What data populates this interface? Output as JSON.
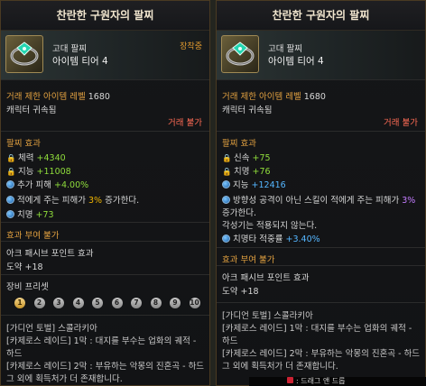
{
  "left": {
    "title": "찬란한 구원자의 팔찌",
    "grade": "고대 팔찌",
    "tier": "아이템 티어 4",
    "equipped": "장착중",
    "level_label": "거래 제한 아이템 레벨",
    "level_value": "1680",
    "bound": "캐릭터 귀속됨",
    "trade": "거래 불가",
    "effect_title": "팔찌 효과",
    "effects": [
      {
        "icon": "lock-icon",
        "name": "체력",
        "value": "+4340"
      },
      {
        "icon": "lock-icon",
        "name": "지능",
        "value": "+11008"
      },
      {
        "icon": "gem-icon",
        "name": "추가 피해",
        "value": "+4.00%"
      }
    ],
    "damage_pre": "적에게 주는 피해가",
    "damage_value": "3%",
    "damage_post": "증가한다.",
    "crit_name": "치명",
    "crit_value": "+73",
    "effect_give": "효과 부여 불가",
    "arc_title": "아크 패시브 포인트 효과",
    "arc_value": "도약 +18",
    "preset_title": "장비 프리셋",
    "preset_numbers": [
      "1",
      "2",
      "3",
      "4",
      "5",
      "6",
      "7",
      "8",
      "9",
      "10"
    ],
    "set_lines": [
      "[가디언 토벌] 스콜라키아",
      "[카제로스 레이드] 1막 : 대지를 부수는 업화의 궤적 -",
      "하드",
      "[카제로스 레이드] 2막 : 부유하는 악몽의 진혼곡 - 하드",
      "그 외에 획득처가 더 존재합니다."
    ]
  },
  "right": {
    "title": "찬란한 구원자의 팔찌",
    "grade": "고대 팔찌",
    "tier": "아이템 티어 4",
    "level_label": "거래 제한 아이템 레벨",
    "level_value": "1680",
    "bound": "캐릭터 귀속됨",
    "trade": "거래 불가",
    "effect_title": "팔찌 효과",
    "effects": [
      {
        "icon": "lock-icon",
        "name": "신속",
        "value": "+75"
      },
      {
        "icon": "lock-icon",
        "name": "치명",
        "value": "+76"
      },
      {
        "icon": "gem-icon",
        "name": "지능",
        "value": "+12416"
      }
    ],
    "dir_pre": "방향성 공격이 아닌 스킬이 적에게 주는 피해가",
    "dir_value": "3%",
    "dir_post": "증가한다.",
    "awaken": "각성기는 적용되지 않는다.",
    "crit_rate_name": "치명타 적중률",
    "crit_rate_value": "+3.40%",
    "effect_give": "효과 부여 불가",
    "arc_title": "아크 패시브 포인트 효과",
    "arc_value": "도약 +18",
    "set_lines": [
      "[가디언 토벌] 스콜라키아",
      "[카제로스 레이드] 1막 : 대지를 부수는 업화의 궤적 -",
      "하드",
      "[카제로스 레이드] 2막 : 부유하는 악몽의 진혼곡 - 하드",
      "그 외에 획득처가 더 존재합니다."
    ],
    "bottom_hint": ": 드래그 앤 드롭"
  }
}
